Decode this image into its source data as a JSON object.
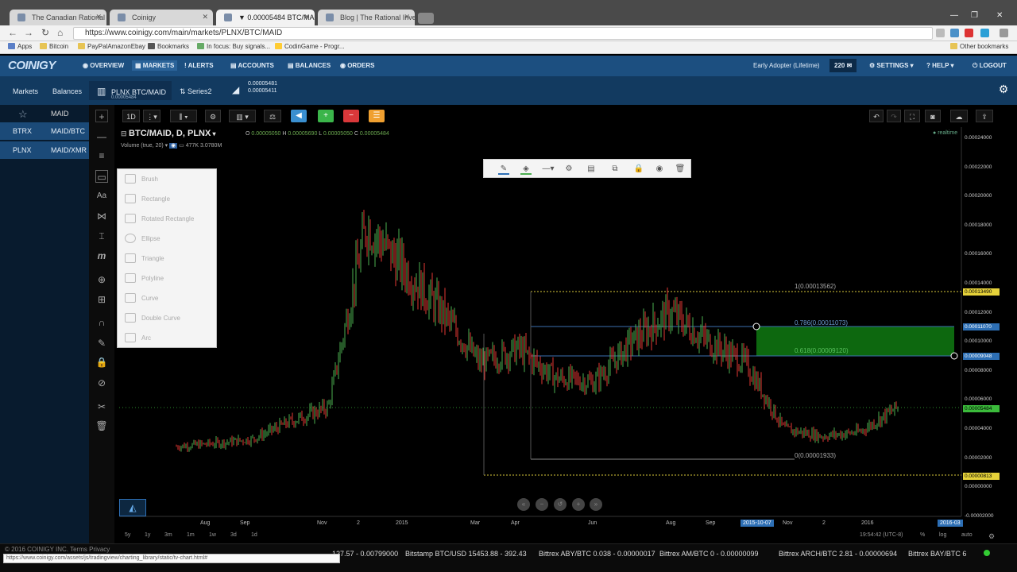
{
  "browser": {
    "tabs": [
      "The Canadian Rational Inv...",
      "Coinigy",
      "▼ 0.00005484 BTC/MAID",
      "Blog | The Rational Invest..."
    ],
    "url": "https://www.coinigy.com/main/markets/PLNX/BTC/MAID",
    "bookmarks": [
      "Apps",
      "Bitcoin",
      "PayPalAmazonEbay",
      "Bookmarks",
      "In focus: Buy signals...",
      "CodinGame - Progr...",
      "Other bookmarks"
    ]
  },
  "nav": {
    "logo": "COINIGY",
    "items": [
      "OVERVIEW",
      "MARKETS",
      "ALERTS",
      "ACCOUNTS",
      "BALANCES",
      "ORDERS"
    ],
    "account": "Early Adopter (Lifetime)",
    "count": "220",
    "right": [
      "SETTINGS",
      "HELP",
      "LOGOUT"
    ]
  },
  "subnav": {
    "markets": "Markets",
    "balances": "Balances",
    "active_pair": "PLNX BTC/MAID",
    "active_price": "0.00005484",
    "series": "Series2",
    "price_hi": "0.00005481",
    "price_lo": "0.00005411"
  },
  "sidebar": {
    "asset": "MAID",
    "rows": [
      {
        "exchange": "BTRX",
        "pair": "MAID/BTC"
      },
      {
        "exchange": "PLNX",
        "pair": "MAID/XMR"
      }
    ]
  },
  "chart_toolbar": {
    "interval": "1D"
  },
  "chart": {
    "title": "BTC/MAID, D, PLNX",
    "ohlc": {
      "o": "0.00005050",
      "h": "0.00005690",
      "l": "0.00005050",
      "c": "0.00005484"
    },
    "volume": "Volume (true, 20)",
    "volume_vals": "477K 3.0780M",
    "realtime": "realtime",
    "fib": [
      "1(0.00013562)",
      "0.786(0.00011073)",
      "0.618(0.00009120)",
      "0(0.00001933)"
    ],
    "price_ticks": [
      "0.00024000",
      "0.00022000",
      "0.00020000",
      "0.00018000",
      "0.00016000",
      "0.00014000",
      "0.00012000",
      "0.00010000",
      "0.00008000",
      "0.00006000",
      "0.00004000",
      "0.00002000",
      "0.00000000",
      "-0.00002000"
    ],
    "price_labels": {
      "fib1": "0.00013490",
      "fib786": "0.00011070",
      "fib618": "0.00009048",
      "last": "0.00005484",
      "low": "0.00000813"
    },
    "x_ticks": [
      "Aug",
      "Sep",
      "Nov",
      "2",
      "2015",
      "Mar",
      "Apr",
      "Jun",
      "Aug",
      "Sep",
      "Nov",
      "2",
      "2016"
    ],
    "cursor_date_left": "2015-10-07",
    "cursor_date_right": "2016-03",
    "ranges": [
      "5y",
      "1y",
      "3m",
      "1m",
      "1w",
      "3d",
      "1d"
    ],
    "time": "19:54:42 (UTC-8)",
    "scale_opts": [
      "%",
      "log",
      "auto"
    ]
  },
  "chart_data": {
    "type": "candlestick",
    "x": [
      "2014-07",
      "2014-08",
      "2014-09",
      "2014-10",
      "2014-11",
      "2014-12",
      "2015-01",
      "2015-02",
      "2015-03",
      "2015-04",
      "2015-05",
      "2015-06",
      "2015-07",
      "2015-08",
      "2015-09",
      "2015-10",
      "2015-11",
      "2015-12",
      "2016-01",
      "2016-02"
    ],
    "close": [
      2.8e-05,
      3e-05,
      3.3e-05,
      4.5e-05,
      5.5e-05,
      0.00018,
      0.00015,
      0.00012,
      8.5e-05,
      9.5e-05,
      7.5e-05,
      7.2e-05,
      0.0001,
      0.00012,
      0.0001,
      8.5e-05,
      4e-05,
      3.5e-05,
      3.8e-05,
      5.5e-05
    ],
    "ylim": [
      -2e-05,
      0.00025
    ]
  },
  "shapes_menu": [
    "Brush",
    "Rectangle",
    "Rotated Rectangle",
    "Ellipse",
    "Triangle",
    "Polyline",
    "Curve",
    "Double Curve",
    "Arc"
  ],
  "ticker": [
    "127.57 - 0.00799000",
    "Bitstamp BTC/USD 15453.88 - 392.43",
    "Bittrex ABY/BTC 0.038 - 0.00000017",
    "Bittrex AM/BTC 0 - 0.00000099",
    "Bittrex ARCH/BTC 2.81 - 0.00000694",
    "Bittrex BAY/BTC 6"
  ],
  "status_bar": "https://www.coinigy.com/assets/js/tradingview/charting_library/static/tv-chart.html#",
  "footer_copy": "© 2016 COINIGY INC. Terms  Privacy"
}
